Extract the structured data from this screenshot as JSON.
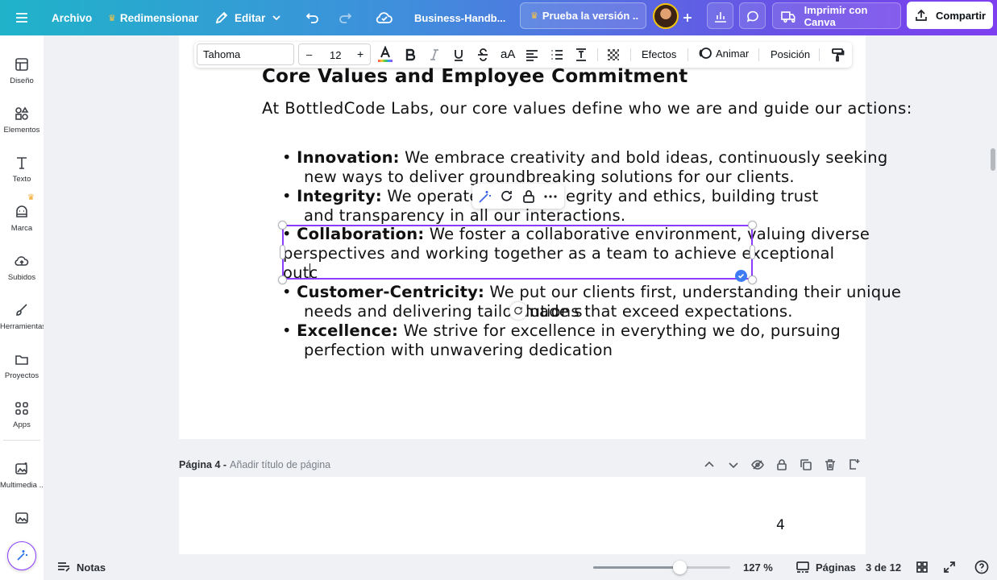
{
  "topbar": {
    "archivo": "Archivo",
    "redimensionar": "Redimensionar",
    "editar": "Editar",
    "doc_title": "Business-Handb...",
    "trial": "Prueba la versión ...",
    "imprimir": "Imprimir con Canva",
    "compartir": "Compartir"
  },
  "sidebar": {
    "items": [
      {
        "label": "Diseño"
      },
      {
        "label": "Elementos"
      },
      {
        "label": "Texto"
      },
      {
        "label": "Marca"
      },
      {
        "label": "Subidos"
      },
      {
        "label": "Herramientas"
      },
      {
        "label": "Proyectos"
      },
      {
        "label": "Apps"
      },
      {
        "label": "Multimedia ..."
      }
    ]
  },
  "toolbar": {
    "font": "Tahoma",
    "size": "12",
    "minus": "–",
    "plus": "+",
    "efectos": "Efectos",
    "animar": "Animar",
    "posicion": "Posición",
    "case": "aA"
  },
  "doc": {
    "heading": "Core Values and Employee Commitment",
    "intro": "At BottledCode Labs, our core values define who we are and guide our actions:",
    "b1_term": "Innovation:",
    "b1_l1": " We embrace creativity and bold ideas, continuously seeking",
    "b1_l2": "new ways to deliver groundbreaking solutions for our clients.",
    "b2_term": "Integrity:",
    "b2_l1a": " We operate with ",
    "b2_l1b": "egrity and ethics, building trust",
    "b2_l2": "and transparency in all our interactions.",
    "b3_term": "Collaboration:",
    "b3_l1": " We foster a collaborative environment, valuing diverse",
    "b3_l2": "perspectives and working together as a team to achieve exceptional",
    "b3_l3": "outc",
    "b4_term": "Customer-Centricity:",
    "b4_l1": " We put our clients first, understanding their unique",
    "b4_l2a": "needs and delivering tailor-made s",
    "b4_l2b": "lutions that exceed expectations.",
    "b5_term": "Excellence:",
    "b5_l1": " We strive for excellence in everything we do, pursuing",
    "b5_l2": "perfection with unwavering dedication",
    "bullet": "•"
  },
  "page4": {
    "label": "Página 4 - ",
    "placeholder": "Añadir título de página",
    "number": "4"
  },
  "bottom": {
    "notas": "Notas",
    "zoom": "127 %",
    "paginas": "Páginas",
    "page_count": "3 de 12",
    "zoom_level": 0.63
  },
  "colors": {
    "accent": "#8b3dff",
    "selection": "#8b3dff"
  }
}
